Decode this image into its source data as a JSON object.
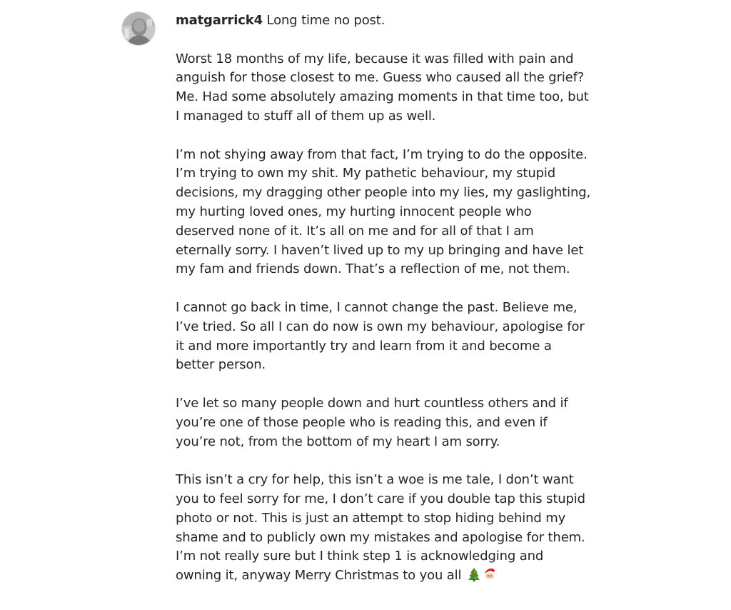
{
  "post": {
    "username": "matgarrick4",
    "first_line_text": " Long time no post.",
    "paragraphs": [
      [
        "Worst 18 months of my life, because it was filled with pain and",
        "anguish for those closest to me. Guess who caused all the grief?",
        "Me. Had some absolutely amazing moments in that time too, but",
        "I managed to stuff all of them up as well."
      ],
      [
        "I’m not shying away from that fact, I’m trying to do the opposite.",
        "I’m trying to own my shit. My pathetic behaviour, my stupid",
        "decisions, my dragging other people into my lies, my gaslighting,",
        "my hurting loved ones, my hurting innocent people who",
        "deserved none of it. It’s all on me and for all of that I am",
        "eternally sorry. I haven’t lived up to my up bringing and have let",
        "my fam and friends down. That’s a reflection of me, not them."
      ],
      [
        "I cannot go back in time, I cannot change the past. Believe me,",
        "I’ve tried. So all I can do now is own my behaviour, apologise for",
        "it and more importantly try and learn from it and become a",
        "better person."
      ],
      [
        "I’ve let so many people down and hurt countless others and if",
        "you’re one of those people who is reading this, and even if",
        "you’re not, from the bottom of my heart I am sorry."
      ],
      [
        "This isn’t a cry for help, this isn’t a woe is me tale, I don’t want",
        "you to feel sorry for me, I don’t care if you double tap this stupid",
        "photo or not. This is just an attempt to stop hiding behind my",
        "shame and to publicly own my mistakes and apologise for them."
      ]
    ],
    "last_paragraph": [
      "I’m not really sure but I think step 1 is acknowledging and",
      "owning it, anyway Merry Christmas to you all "
    ],
    "emojis": [
      "christmas-tree-icon",
      "santa-face-icon"
    ]
  },
  "colors": {
    "text": "#262626",
    "background": "#ffffff"
  }
}
